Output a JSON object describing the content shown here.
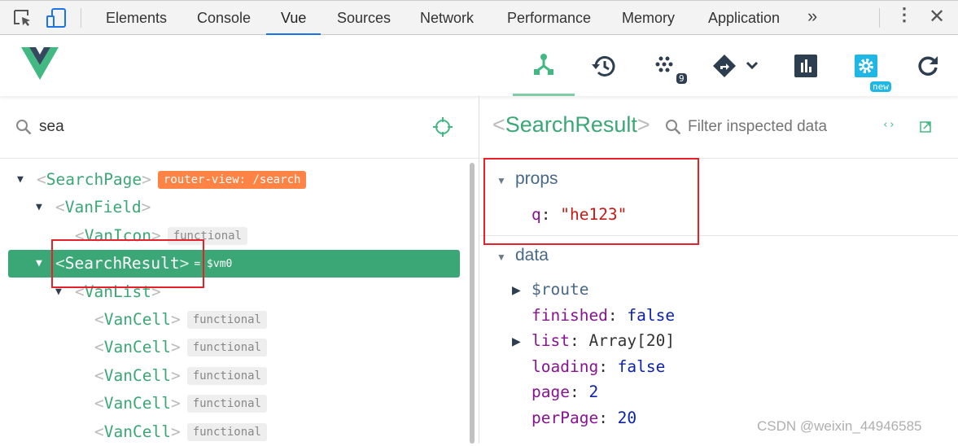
{
  "devtools_tabs": [
    {
      "label": "Elements",
      "active": false
    },
    {
      "label": "Console",
      "active": false
    },
    {
      "label": "Vue",
      "active": true
    },
    {
      "label": "Sources",
      "active": false
    },
    {
      "label": "Network",
      "active": false
    },
    {
      "label": "Performance",
      "active": false
    },
    {
      "label": "Memory",
      "active": false
    },
    {
      "label": "Application",
      "active": false
    }
  ],
  "toolbar": {
    "icons": [
      "components-icon",
      "history-icon",
      "events-icon",
      "router-icon",
      "performance-icon",
      "settings-icon",
      "refresh-icon"
    ],
    "events_count": "9",
    "settings_badge": "new",
    "accent": "#42b883",
    "settings_color": "#1fb8e6"
  },
  "search": {
    "value": "sea"
  },
  "tree": [
    {
      "name": "SearchPage",
      "depth": 0,
      "expanded": true,
      "tag": "router-view: /search",
      "tag_type": "router"
    },
    {
      "name": "VanField",
      "depth": 1,
      "expanded": true
    },
    {
      "name": "VanIcon",
      "depth": 2,
      "tag": "functional",
      "tag_type": "func"
    },
    {
      "name": "SearchResult",
      "depth": 1,
      "expanded": true,
      "selected": true,
      "vm": "= $vm0"
    },
    {
      "name": "VanList",
      "depth": 2,
      "expanded": true
    },
    {
      "name": "VanCell",
      "depth": 3,
      "tag": "functional",
      "tag_type": "func"
    },
    {
      "name": "VanCell",
      "depth": 3,
      "tag": "functional",
      "tag_type": "func"
    },
    {
      "name": "VanCell",
      "depth": 3,
      "tag": "functional",
      "tag_type": "func"
    },
    {
      "name": "VanCell",
      "depth": 3,
      "tag": "functional",
      "tag_type": "func"
    },
    {
      "name": "VanCell",
      "depth": 3,
      "tag": "functional",
      "tag_type": "func"
    }
  ],
  "inspector": {
    "component": "SearchResult",
    "filter_placeholder": "Filter inspected data",
    "props_label": "props",
    "props": [
      {
        "key": "q",
        "value": "\"he123\"",
        "type": "str"
      }
    ],
    "data_label": "data",
    "data": [
      {
        "key": "$route",
        "value": "",
        "type": "obj",
        "expandable": true
      },
      {
        "key": "finished",
        "value": "false",
        "type": "num"
      },
      {
        "key": "list",
        "value": "Array[20]",
        "type": "plain",
        "expandable": true
      },
      {
        "key": "loading",
        "value": "false",
        "type": "num"
      },
      {
        "key": "page",
        "value": "2",
        "type": "num"
      },
      {
        "key": "perPage",
        "value": "20",
        "type": "num"
      }
    ]
  },
  "watermark": "CSDN @weixin_44946585"
}
